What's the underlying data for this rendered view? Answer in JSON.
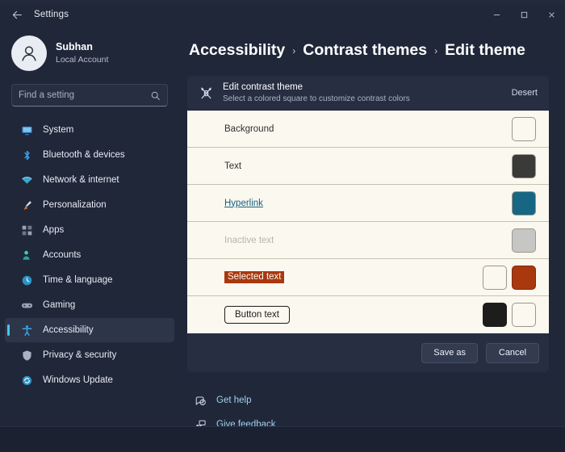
{
  "window": {
    "title": "Settings",
    "back_icon": "back-arrow-icon",
    "controls": {
      "minimize": "–",
      "maximize": "□",
      "close": "✕"
    }
  },
  "sidebar": {
    "profile": {
      "name": "Subhan",
      "subtitle": "Local Account",
      "avatar_icon": "person-avatar-icon"
    },
    "search": {
      "placeholder": "Find a setting",
      "value": "",
      "icon": "search-icon"
    },
    "items": [
      {
        "label": "System",
        "icon": "monitor-icon",
        "active": false
      },
      {
        "label": "Bluetooth & devices",
        "icon": "bluetooth-icon",
        "active": false
      },
      {
        "label": "Network & internet",
        "icon": "wifi-icon",
        "active": false
      },
      {
        "label": "Personalization",
        "icon": "paintbrush-icon",
        "active": false
      },
      {
        "label": "Apps",
        "icon": "apps-grid-icon",
        "active": false
      },
      {
        "label": "Accounts",
        "icon": "accounts-people-icon",
        "active": false
      },
      {
        "label": "Time & language",
        "icon": "clock-globe-icon",
        "active": false
      },
      {
        "label": "Gaming",
        "icon": "gamepad-icon",
        "active": false
      },
      {
        "label": "Accessibility",
        "icon": "accessibility-person-icon",
        "active": true
      },
      {
        "label": "Privacy & security",
        "icon": "shield-icon",
        "active": false
      },
      {
        "label": "Windows Update",
        "icon": "update-refresh-icon",
        "active": false
      }
    ]
  },
  "main": {
    "breadcrumb": {
      "items": [
        "Accessibility",
        "Contrast themes",
        "Edit theme"
      ],
      "separator": "›"
    },
    "card": {
      "header": {
        "icon": "edit-contrast-theme-icon",
        "title": "Edit contrast theme",
        "subtitle": "Select a colored square to customize contrast colors",
        "theme_name": "Desert"
      },
      "preview_background": "#fbf8ef",
      "rows": [
        {
          "label": "Background",
          "style": "normal",
          "swatches": [
            "#fbf8ef"
          ]
        },
        {
          "label": "Text",
          "style": "normal",
          "swatches": [
            "#3a3a38"
          ]
        },
        {
          "label": "Hyperlink",
          "style": "link",
          "swatches": [
            "#176684"
          ]
        },
        {
          "label": "Inactive text",
          "style": "inactive",
          "swatches": [
            "#c6c6c4"
          ]
        },
        {
          "label": "Selected text",
          "style": "selected",
          "swatches": [
            "#fbf8ef",
            "#a9380f"
          ]
        },
        {
          "label": "Button text",
          "style": "button",
          "swatches": [
            "#1d1d1b",
            "#fbf8ef"
          ]
        }
      ],
      "footer": {
        "save_label": "Save as",
        "cancel_label": "Cancel"
      }
    },
    "footer_links": [
      {
        "label": "Get help",
        "icon": "get-help-icon"
      },
      {
        "label": "Give feedback",
        "icon": "give-feedback-icon"
      }
    ]
  },
  "colors": {
    "page_bg": "#202739",
    "card_bg": "#272e42",
    "accent": "#4cc2ff",
    "link": "#9fd2ea"
  }
}
